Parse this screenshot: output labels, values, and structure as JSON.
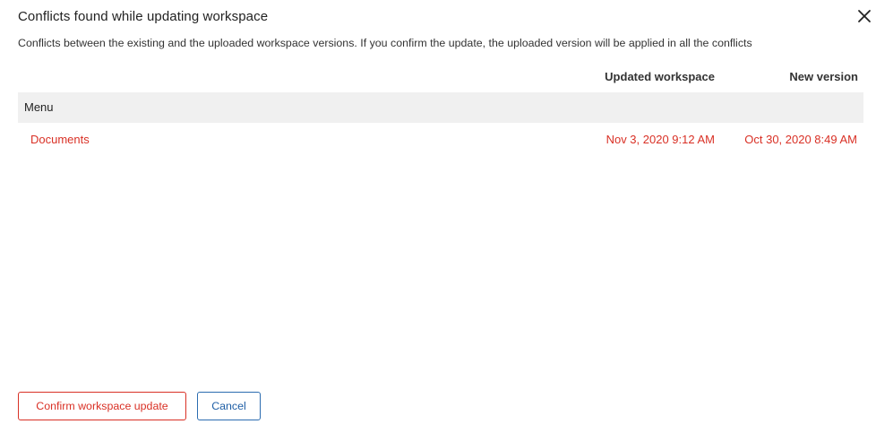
{
  "dialog": {
    "title": "Conflicts found while updating workspace",
    "description": "Conflicts between the existing and the uploaded workspace versions. If you confirm the update, the uploaded version will be applied in all the conflicts",
    "close_icon": "close-icon"
  },
  "table": {
    "columns": {
      "updated_workspace": "Updated workspace",
      "new_version": "New version"
    },
    "groups": [
      {
        "label": "Menu",
        "rows": [
          {
            "name": "Documents",
            "updated_workspace": "Nov 3, 2020 9:12 AM",
            "new_version": "Oct 30, 2020 8:49 AM"
          }
        ]
      }
    ]
  },
  "footer": {
    "confirm_label": "Confirm workspace update",
    "cancel_label": "Cancel"
  },
  "colors": {
    "conflict_text": "#d93025",
    "confirm_border": "#d93025",
    "cancel_border": "#2b6cb0",
    "group_background": "#f0f0f0"
  }
}
